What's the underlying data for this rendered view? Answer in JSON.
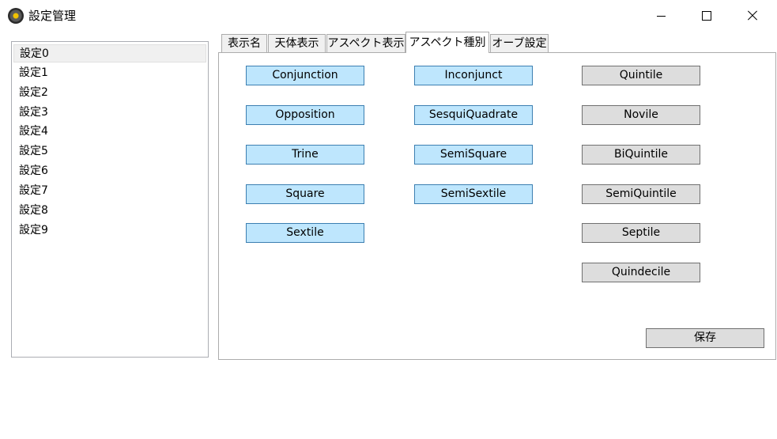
{
  "window": {
    "title": "設定管理"
  },
  "sidebar": {
    "items": [
      "設定0",
      "設定1",
      "設定2",
      "設定3",
      "設定4",
      "設定5",
      "設定6",
      "設定7",
      "設定8",
      "設定9"
    ],
    "selected_index": 0
  },
  "tabs": [
    {
      "label": "表示名",
      "active": false
    },
    {
      "label": "天体表示",
      "active": false
    },
    {
      "label": "アスペクト表示",
      "active": false
    },
    {
      "label": "アスペクト種別",
      "active": true
    },
    {
      "label": "オーブ設定",
      "active": false
    }
  ],
  "aspects": {
    "major": [
      {
        "label": "Conjunction",
        "enabled": true
      },
      {
        "label": "Opposition",
        "enabled": true
      },
      {
        "label": "Trine",
        "enabled": true
      },
      {
        "label": "Square",
        "enabled": true
      },
      {
        "label": "Sextile",
        "enabled": true
      }
    ],
    "minor": [
      {
        "label": "Inconjunct",
        "enabled": true
      },
      {
        "label": "SesquiQuadrate",
        "enabled": true
      },
      {
        "label": "SemiSquare",
        "enabled": true
      },
      {
        "label": "SemiSextile",
        "enabled": true
      }
    ],
    "other": [
      {
        "label": "Quintile",
        "enabled": false
      },
      {
        "label": "Novile",
        "enabled": false
      },
      {
        "label": "BiQuintile",
        "enabled": false
      },
      {
        "label": "SemiQuintile",
        "enabled": false
      },
      {
        "label": "Septile",
        "enabled": false
      },
      {
        "label": "Quindecile",
        "enabled": false
      }
    ]
  },
  "save_label": "保存",
  "colors": {
    "toggle_on_bg": "#bee6fd",
    "toggle_on_border": "#3c7fb1",
    "toggle_off_bg": "#dddddd",
    "toggle_off_border": "#707070"
  }
}
